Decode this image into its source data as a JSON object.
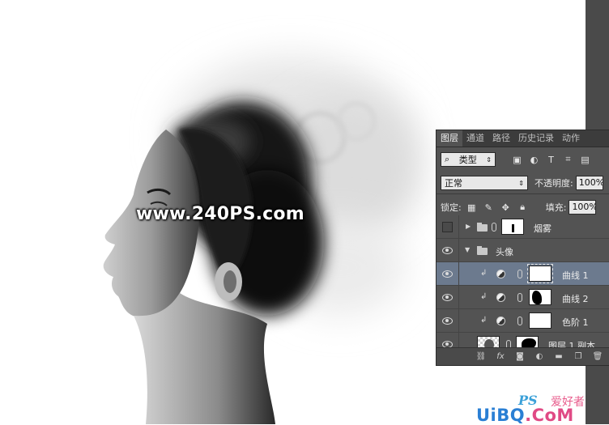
{
  "watermark_text": "www.240PS.com",
  "site_logo": {
    "ps": "PS",
    "cn": "爱好者",
    "big_a": "UiBQ",
    "big_b": ".CoM"
  },
  "panel": {
    "tabs": [
      "图层",
      "通道",
      "路径",
      "历史记录",
      "动作"
    ],
    "filter_label": "类型",
    "blend_mode": "正常",
    "opacity_label": "不透明度:",
    "opacity_value": "100%",
    "lock_label": "锁定:",
    "fill_label": "填充:",
    "fill_value": "100%",
    "layers": [
      {
        "name": "烟雾",
        "visible": false,
        "type": "group-collapsed"
      },
      {
        "name": "头像",
        "visible": true,
        "type": "group-expanded"
      },
      {
        "name": "曲线 1",
        "visible": true,
        "type": "adjustment",
        "selected": true
      },
      {
        "name": "曲线 2",
        "visible": true,
        "type": "adjustment"
      },
      {
        "name": "色阶 1",
        "visible": true,
        "type": "adjustment"
      },
      {
        "name": "图层 1 副本",
        "visible": true,
        "type": "pixel"
      }
    ]
  },
  "colors": {
    "panel_bg": "#535353",
    "tab_bar": "#3c3c3c",
    "selected_row": "#6c7a8e",
    "side_strip": "#4a4a4a"
  }
}
